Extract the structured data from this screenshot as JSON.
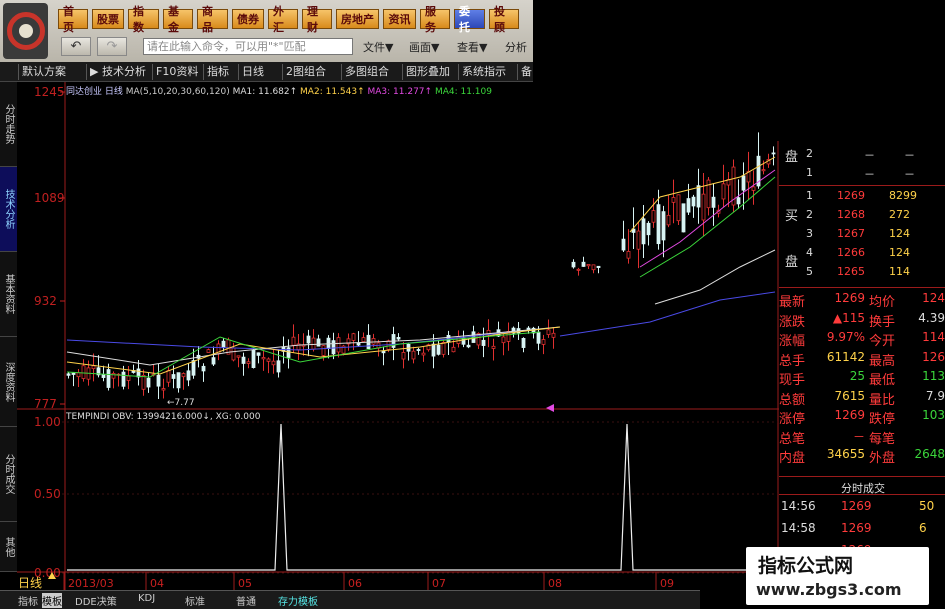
{
  "menu": {
    "items": [
      "首页",
      "股票",
      "指数",
      "基金",
      "商品",
      "债券",
      "外汇",
      "理财",
      "房地产",
      "资讯",
      "服务",
      "委托",
      "投顾"
    ],
    "command_placeholder": "请在此输入命令，可以用\"*\"匹配",
    "file": "文件▼",
    "view": "画面▼",
    "look": "查看▼",
    "analysis": "分析"
  },
  "toolbar": {
    "items": [
      "默认方案",
      "▶ 技术分析",
      "F10资料",
      "指标",
      "日线",
      "2图组合",
      "多图组合",
      "图形叠加",
      "系统指示",
      "备"
    ]
  },
  "vtabs": [
    "分时走势",
    "技术分析",
    "基本资料",
    "深度资料",
    "分时成交",
    "其他"
  ],
  "chart": {
    "stock_name": "同达创业 日线",
    "ma_params": "MA(5,10,20,30,60,120)",
    "ma1_label": "MA1: 11.682↑",
    "ma2_label": "MA2: 11.543↑",
    "ma3_label": "MA3: 11.277↑",
    "ma4_label": "MA4: 11.109",
    "y_labels": [
      "1245",
      "1089",
      "932",
      "777"
    ],
    "low_mark": "←7.77",
    "indicator_label": "TEMPINDI OBV: 13994216.000↓, XG: 0.000",
    "ind_y_labels": [
      "1.00",
      "0.50",
      "0.00"
    ],
    "period": "日线",
    "x_labels": [
      "2013/03",
      "04",
      "05",
      "06",
      "07",
      "08",
      "09"
    ]
  },
  "chart_data": {
    "type": "candlestick",
    "ylabel": "",
    "ylim": [
      7.77,
      12.45
    ],
    "series": [
      {
        "name": "XG",
        "x": [
          "2013/05",
          "2013/08"
        ],
        "values": [
          1,
          1
        ]
      }
    ]
  },
  "orderbook": {
    "sell": [
      {
        "side_label": "盘",
        "level": "2",
        "price": "－",
        "volume": "－"
      },
      {
        "side_label": "",
        "level": "1",
        "price": "－",
        "volume": "－"
      }
    ],
    "buy": [
      {
        "level": "1",
        "price": "1269",
        "volume": "8299"
      },
      {
        "level": "2",
        "price": "1268",
        "volume": "272"
      },
      {
        "level": "3",
        "price": "1267",
        "volume": "124"
      },
      {
        "level": "4",
        "price": "1266",
        "volume": "124"
      },
      {
        "level": "5",
        "price": "1265",
        "volume": "114"
      }
    ],
    "buy_label_top": "买",
    "buy_label_bottom": "盘"
  },
  "quote": {
    "rows": [
      {
        "l": "最新",
        "lv": "1269",
        "r": "均价",
        "rv": "124"
      },
      {
        "l": "涨跌",
        "lv": "▲115",
        "r": "换手",
        "rv": "4.39"
      },
      {
        "l": "涨幅",
        "lv": "9.97%",
        "r": "今开",
        "rv": "114"
      },
      {
        "l": "总手",
        "lv": "61142",
        "r": "最高",
        "rv": "126"
      },
      {
        "l": "现手",
        "lv": "25",
        "r": "最低",
        "rv": "113"
      },
      {
        "l": "总额",
        "lv": "7615",
        "r": "量比",
        "rv": "7.9"
      },
      {
        "l": "涨停",
        "lv": "1269",
        "r": "跌停",
        "rv": "103"
      },
      {
        "l": "总笔",
        "lv": "－",
        "r": "每笔",
        "rv": ""
      },
      {
        "l": "内盘",
        "lv": "34655",
        "r": "外盘",
        "rv": "2648"
      }
    ],
    "trades_title": "分时成交",
    "trades": [
      {
        "time": "14:56",
        "price": "1269",
        "vol": "50"
      },
      {
        "time": "14:58",
        "price": "1269",
        "vol": "6"
      },
      {
        "time": "",
        "price": "1269",
        "vol": ""
      }
    ]
  },
  "bottom_tabs": [
    "指标",
    "模板",
    "DDE决策",
    "KDJ",
    "标准",
    "普通",
    "存力模板"
  ],
  "watermark": {
    "line1": "指标公式网",
    "line2": "www.zbgs3.com"
  }
}
